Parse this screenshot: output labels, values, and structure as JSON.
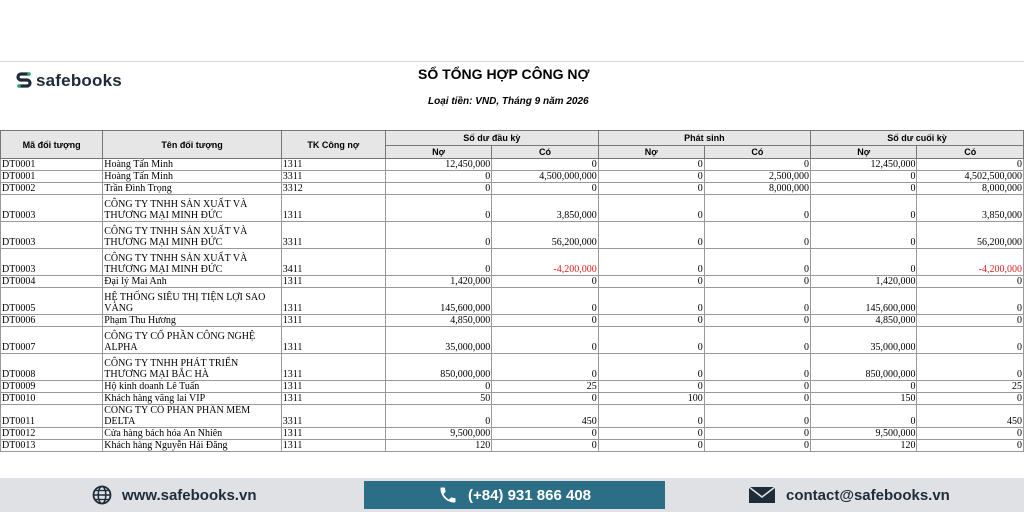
{
  "brand": {
    "name": "safebooks"
  },
  "report": {
    "title": "SỔ TỔNG HỢP CÔNG NỢ",
    "subtitle": "Loại tiền: VND, Tháng 9 năm 2026"
  },
  "headers": {
    "code": "Mã đối tượng",
    "name": "Tên đối tượng",
    "account": "TK Công nợ",
    "opening": "Số dư đầu kỳ",
    "movement": "Phát sinh",
    "closing": "Số dư cuối kỳ",
    "debit": "Nợ",
    "credit": "Có"
  },
  "rows": [
    {
      "code": "DT0001",
      "name": "Hoàng Tấn Minh",
      "acct": "1311",
      "od": "12,450,000",
      "oc": "0",
      "md": "0",
      "mc": "0",
      "cd": "12,450,000",
      "cc": "0"
    },
    {
      "code": "DT0001",
      "name": "Hoàng Tấn Minh",
      "acct": "3311",
      "od": "0",
      "oc": "4,500,000,000",
      "md": "0",
      "mc": "2,500,000",
      "cd": "0",
      "cc": "4,502,500,000"
    },
    {
      "code": "DT0002",
      "name": "Trần Đình Trọng",
      "acct": "3312",
      "od": "0",
      "oc": "0",
      "md": "0",
      "mc": "8,000,000",
      "cd": "0",
      "cc": "8,000,000"
    },
    {
      "code": "DT0003",
      "name": "CÔNG TY TNHH SẢN XUẤT VÀ THƯƠNG MẠI MINH ĐỨC",
      "acct": "1311",
      "od": "0",
      "oc": "3,850,000",
      "md": "0",
      "mc": "0",
      "cd": "0",
      "cc": "3,850,000"
    },
    {
      "code": "DT0003",
      "name": "CÔNG TY TNHH SẢN XUẤT VÀ THƯƠNG MẠI MINH ĐỨC",
      "acct": "3311",
      "od": "0",
      "oc": "56,200,000",
      "md": "0",
      "mc": "0",
      "cd": "0",
      "cc": "56,200,000"
    },
    {
      "code": "DT0003",
      "name": "CÔNG TY TNHH SẢN XUẤT VÀ THƯƠNG MẠI MINH ĐỨC",
      "acct": "3411",
      "od": "0",
      "oc": "-4,200,000",
      "md": "0",
      "mc": "0",
      "cd": "0",
      "cc": "-4,200,000"
    },
    {
      "code": "DT0004",
      "name": "Đại lý Mai Anh",
      "acct": "1311",
      "od": "1,420,000",
      "oc": "0",
      "md": "0",
      "mc": "0",
      "cd": "1,420,000",
      "cc": "0"
    },
    {
      "code": "DT0005",
      "name": "HỆ THỐNG SIÊU THỊ TIỆN LỢI SAO VÀNG",
      "acct": "1311",
      "od": "145,600,000",
      "oc": "0",
      "md": "0",
      "mc": "0",
      "cd": "145,600,000",
      "cc": "0"
    },
    {
      "code": "DT0006",
      "name": "Phạm Thu Hương",
      "acct": "1311",
      "od": "4,850,000",
      "oc": "0",
      "md": "0",
      "mc": "0",
      "cd": "4,850,000",
      "cc": "0"
    },
    {
      "code": "DT0007",
      "name": "CÔNG TY CỔ PHẦN CÔNG NGHỆ ALPHA",
      "acct": "1311",
      "od": "35,000,000",
      "oc": "0",
      "md": "0",
      "mc": "0",
      "cd": "35,000,000",
      "cc": "0"
    },
    {
      "code": "DT0008",
      "name": "CÔNG TY TNHH PHÁT TRIỂN THƯƠNG MẠI BẮC HÀ",
      "acct": "1311",
      "od": "850,000,000",
      "oc": "0",
      "md": "0",
      "mc": "0",
      "cd": "850,000,000",
      "cc": "0"
    },
    {
      "code": "DT0009",
      "name": "Hộ kinh doanh Lê Tuấn",
      "acct": "1311",
      "od": "0",
      "oc": "25",
      "md": "0",
      "mc": "0",
      "cd": "0",
      "cc": "25"
    },
    {
      "code": "DT0010",
      "name": "Khách hàng vãng lai VIP",
      "acct": "1311",
      "od": "50",
      "oc": "0",
      "md": "100",
      "mc": "0",
      "cd": "150",
      "cc": "0"
    },
    {
      "code": "DT0011",
      "name": "CÔNG TY CỔ PHẦN PHẦN MỀM DELTA",
      "acct": "3311",
      "od": "0",
      "oc": "450",
      "md": "0",
      "mc": "0",
      "cd": "0",
      "cc": "450"
    },
    {
      "code": "DT0012",
      "name": "Cửa hàng bách hóa An Nhiên",
      "acct": "1311",
      "od": "9,500,000",
      "oc": "0",
      "md": "0",
      "mc": "0",
      "cd": "9,500,000",
      "cc": "0"
    },
    {
      "code": "DT0013",
      "name": "Khách hàng Nguyễn Hải Đăng",
      "acct": "1311",
      "od": "120",
      "oc": "0",
      "md": "0",
      "mc": "0",
      "cd": "120",
      "cc": "0"
    }
  ],
  "footer": {
    "website": "www.safebooks.vn",
    "phone": "(+84) 931 866 408",
    "email": "contact@safebooks.vn"
  },
  "colors": {
    "header_bg": "#e7e6e6",
    "negative": "#e02020",
    "footer_bg": "#dfe1e4",
    "phone_bg": "#2c6e86",
    "brand_green": "#26a96c"
  }
}
